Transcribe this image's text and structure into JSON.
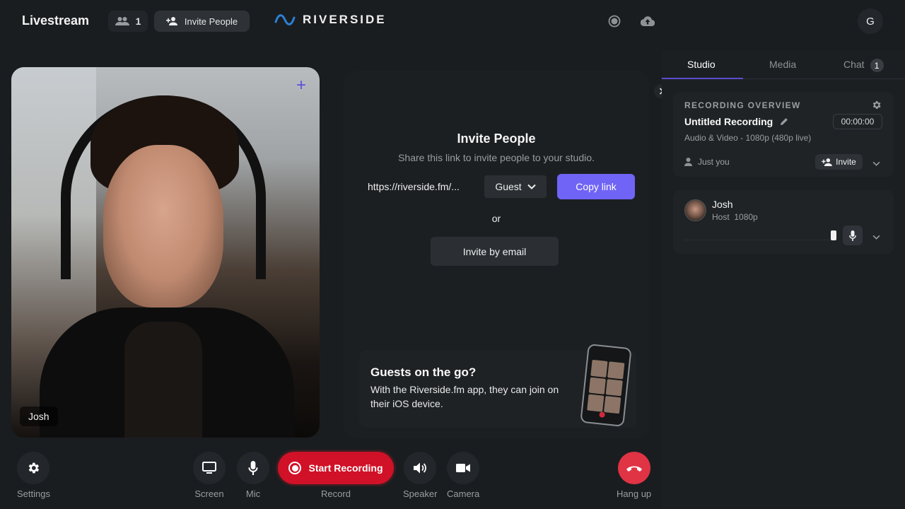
{
  "topbar": {
    "title": "Livestream",
    "people_count": "1",
    "invite_label": "Invite People",
    "logo_text": "RIVERSIDE",
    "avatar_initial": "G",
    "icons": [
      "people-icon",
      "add-person-icon",
      "riverside-wave-logo",
      "record-status-icon",
      "cloud-upload-icon"
    ]
  },
  "video": {
    "participant_name": "Josh",
    "add_icon": "plus-icon"
  },
  "invite_panel": {
    "title": "Invite People",
    "subtitle": "Share this link to invite people to your studio.",
    "link": "https://riverside.fm/...",
    "role": "Guest",
    "copy_label": "Copy link",
    "or_label": "or",
    "email_label": "Invite by email",
    "promo_title": "Guests on the go?",
    "promo_body": "With the Riverside.fm app, they can join on their iOS device."
  },
  "sidebar": {
    "tabs": [
      {
        "label": "Studio",
        "active": true
      },
      {
        "label": "Media",
        "active": false
      },
      {
        "label": "Chat",
        "active": false,
        "badge": "1"
      }
    ],
    "recording": {
      "section_label": "RECORDING OVERVIEW",
      "title": "Untitled Recording",
      "timer": "00:00:00",
      "quality": "Audio & Video - 1080p (480p live)",
      "who": "Just you",
      "invite_label": "Invite"
    },
    "participant": {
      "name": "Josh",
      "role": "Host",
      "resolution": "1080p"
    }
  },
  "controls": {
    "settings": "Settings",
    "screen": "Screen",
    "mic": "Mic",
    "record_button": "Start Recording",
    "record": "Record",
    "speaker": "Speaker",
    "camera": "Camera",
    "hangup": "Hang up"
  },
  "colors": {
    "accent": "#7064f6",
    "record_red": "#d01127",
    "hangup_red": "#e03344",
    "logo_blue": "#2d7fd6",
    "background": "#1a1d20"
  }
}
